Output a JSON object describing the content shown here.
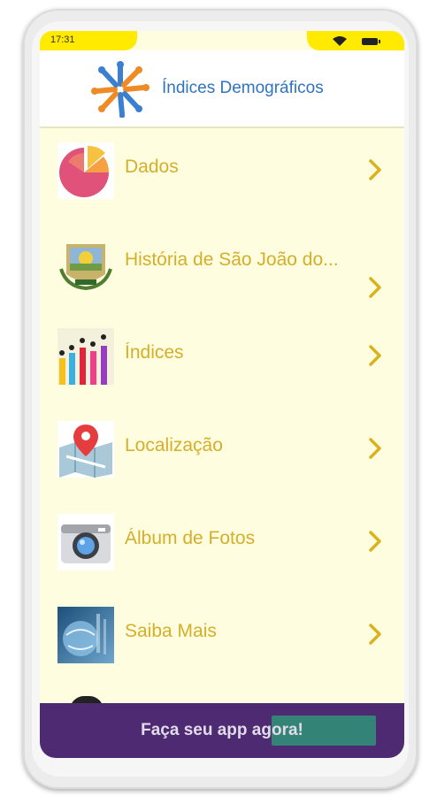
{
  "status_bar": {
    "time": "17:31",
    "wifi_icon": "wifi-icon",
    "battery_icon": "battery-icon"
  },
  "header": {
    "title": "Índices Demográficos",
    "logo_icon": "people-logo-icon"
  },
  "menu": {
    "items": [
      {
        "label": "Dados",
        "icon": "pie-chart-icon"
      },
      {
        "label": "História de São João do...",
        "icon": "city-crest-icon"
      },
      {
        "label": "Índices",
        "icon": "rising-arrows-people-icon"
      },
      {
        "label": "Localização",
        "icon": "map-pin-icon"
      },
      {
        "label": "Álbum de Fotos",
        "icon": "camera-icon"
      },
      {
        "label": "Saiba Mais",
        "icon": "globe-photo-icon"
      }
    ]
  },
  "promo": {
    "text": "Faça seu app agora!"
  },
  "colors": {
    "accent_yellow": "#ffea00",
    "label_gold": "#d4af2a",
    "title_blue": "#2f74c0",
    "banner_purple": "#4e2a72",
    "list_bg": "#fffde0"
  }
}
